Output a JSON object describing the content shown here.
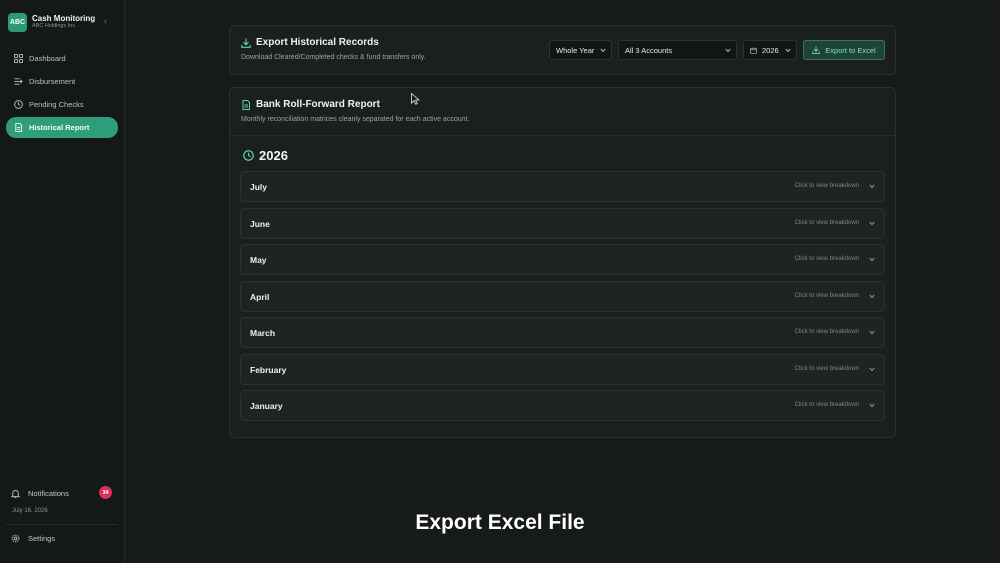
{
  "brand": {
    "logo_text": "ABC",
    "title": "Cash Monitoring",
    "subtitle": "ABC Holdings Inc.",
    "accent": "#2f9d7c"
  },
  "sidebar": {
    "collapse_icon": "chevron-left-icon",
    "items": [
      {
        "label": "Dashboard",
        "icon": "grid-icon",
        "active": false
      },
      {
        "label": "Disbursement",
        "icon": "list-arrow-icon",
        "active": false
      },
      {
        "label": "Pending Checks",
        "icon": "clock-icon",
        "active": false
      },
      {
        "label": "Historical Report",
        "icon": "document-icon",
        "active": true
      }
    ],
    "notifications": {
      "label": "Notifications",
      "count": "34",
      "icon": "bell-icon"
    },
    "date": "July 16, 2026",
    "settings": {
      "label": "Settings",
      "icon": "gear-icon"
    }
  },
  "export": {
    "title": "Export Historical Records",
    "subtitle": "Download Cleared/Completed checks & fund transfers only.",
    "period": "Whole Year",
    "accounts": "All 3 Accounts",
    "year": "2026",
    "button": "Export to Excel"
  },
  "report": {
    "title": "Bank Roll-Forward Report",
    "subtitle": "Monthly reconciliation matrices cleanly separated for each active account.",
    "year": "2026",
    "months": [
      {
        "name": "July",
        "hint": "Click to view breakdown"
      },
      {
        "name": "June",
        "hint": "Click to view breakdown"
      },
      {
        "name": "May",
        "hint": "Click to view breakdown"
      },
      {
        "name": "April",
        "hint": "Click to view breakdown"
      },
      {
        "name": "March",
        "hint": "Click to view breakdown"
      },
      {
        "name": "February",
        "hint": "Click to view breakdown"
      },
      {
        "name": "January",
        "hint": "Click to view breakdown"
      }
    ]
  },
  "caption": "Export Excel File"
}
